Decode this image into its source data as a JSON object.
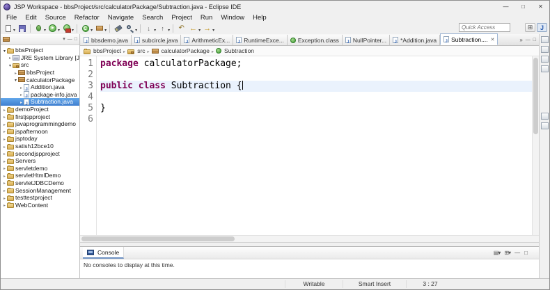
{
  "window": {
    "title": "JSP Workspace - bbsProject/src/calculatorPackage/Subtraction.java - Eclipse IDE",
    "controls": {
      "minimize": "—",
      "maximize": "□",
      "close": "✕"
    }
  },
  "menubar": {
    "items": [
      "File",
      "Edit",
      "Source",
      "Refactor",
      "Navigate",
      "Search",
      "Project",
      "Run",
      "Window",
      "Help"
    ]
  },
  "toolbar": {
    "quick_access_placeholder": "Quick Access"
  },
  "tabbar": {
    "tabs": [
      {
        "label": "bbsdemo.java"
      },
      {
        "label": "subcircle.java"
      },
      {
        "label": "ArithmeticEx..."
      },
      {
        "label": "RuntimeExce..."
      },
      {
        "label": "Exception.class"
      },
      {
        "label": "NullPointer..."
      },
      {
        "label": "*Addition.java"
      },
      {
        "label": "Subtraction...."
      }
    ],
    "overflow": "»",
    "close_glyph": "✕"
  },
  "breadcrumb": {
    "items": [
      "bbsProject",
      "src",
      "calculatorPackage",
      "Subtraction"
    ]
  },
  "editor": {
    "line_numbers": [
      "1",
      "2",
      "3",
      "4",
      "5",
      "6"
    ],
    "code": [
      {
        "kw": "package",
        "rest": " calculatorPackage;"
      },
      {
        "kw": "",
        "rest": ""
      },
      {
        "kw": "public class",
        "rest": " Subtraction {"
      },
      {
        "kw": "",
        "rest": ""
      },
      {
        "kw": "",
        "rest": "}"
      },
      {
        "kw": "",
        "rest": ""
      }
    ]
  },
  "explorer": {
    "items": [
      {
        "label": "bbsProject"
      },
      {
        "label": "JRE System Library [Java..."
      },
      {
        "label": "src"
      },
      {
        "label": "bbsProject"
      },
      {
        "label": "calculatorPackage"
      },
      {
        "label": "Addition.java"
      },
      {
        "label": "package-info.java"
      },
      {
        "label": "Subtraction.java"
      },
      {
        "label": "demoProject"
      },
      {
        "label": "firstjspproject"
      },
      {
        "label": "javaprogrammingdemo"
      },
      {
        "label": "jspafternoon"
      },
      {
        "label": "jsptoday"
      },
      {
        "label": "satish12bce10"
      },
      {
        "label": "secondjspproject"
      },
      {
        "label": "Servers"
      },
      {
        "label": "servletdemo"
      },
      {
        "label": "servletHtmlDemo"
      },
      {
        "label": "servletJDBCDemo"
      },
      {
        "label": "SessionManagement"
      },
      {
        "label": "testtestproject"
      },
      {
        "label": "WebContent"
      }
    ]
  },
  "console": {
    "tab_label": "Console",
    "message": "No consoles to display at this time."
  },
  "statusbar": {
    "writable": "Writable",
    "insert_mode": "Smart Insert",
    "caret_position": "3 : 27"
  },
  "colors": {
    "keyword": "#7f0055",
    "selection_bg": "#3f7fd0"
  }
}
